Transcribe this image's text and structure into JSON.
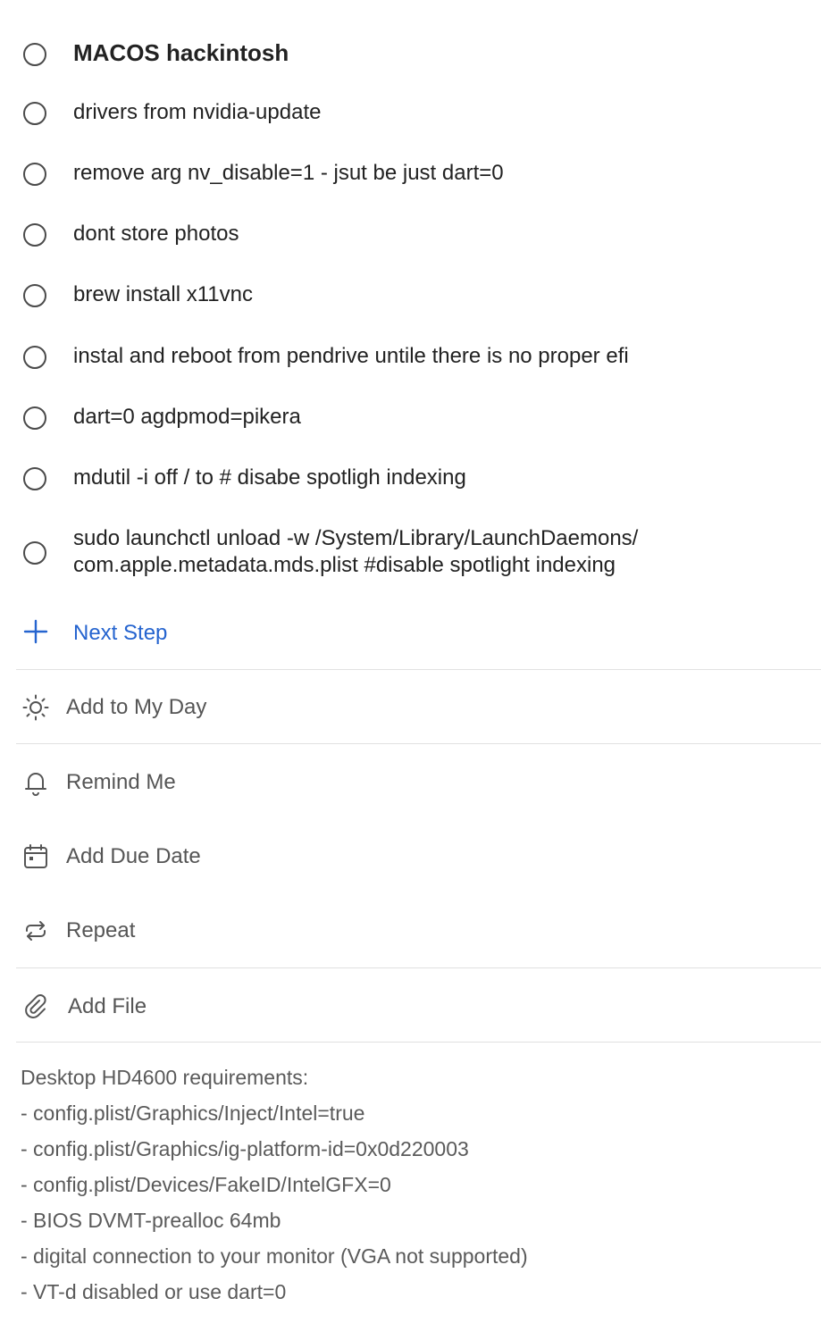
{
  "task": {
    "title": "MACOS hackintosh"
  },
  "steps": [
    "drivers from nvidia-update",
    "remove arg  nv_disable=1 - jsut be just dart=0",
    "dont store photos",
    "brew install x11vnc",
    "instal and reboot from pendrive untile there is no proper efi",
    "dart=0 agdpmod=pikera",
    "mdutil -i off / to # disabe spotligh indexing"
  ],
  "last_step": {
    "line1": "sudo launchctl unload -w /System/Library/LaunchDaemons/",
    "line2": "com.apple.metadata.mds.plist #disable spotlight indexing"
  },
  "next_step_label": "Next Step",
  "actions": {
    "my_day": "Add to My Day",
    "remind": "Remind Me",
    "due_date": "Add Due Date",
    "repeat": "Repeat",
    "add_file": "Add File"
  },
  "notes": [
    "Desktop HD4600 requirements:",
    "- config.plist/Graphics/Inject/Intel=true",
    "- config.plist/Graphics/ig-platform-id=0x0d220003",
    "- config.plist/Devices/FakeID/IntelGFX=0",
    "- BIOS DVMT-prealloc 64mb",
    "- digital connection to your monitor (VGA not supported)",
    "- VT-d disabled or use dart=0"
  ],
  "colors": {
    "accent": "#2564cf",
    "text": "#222222",
    "muted": "#555555",
    "divider": "#e1e1e1"
  }
}
